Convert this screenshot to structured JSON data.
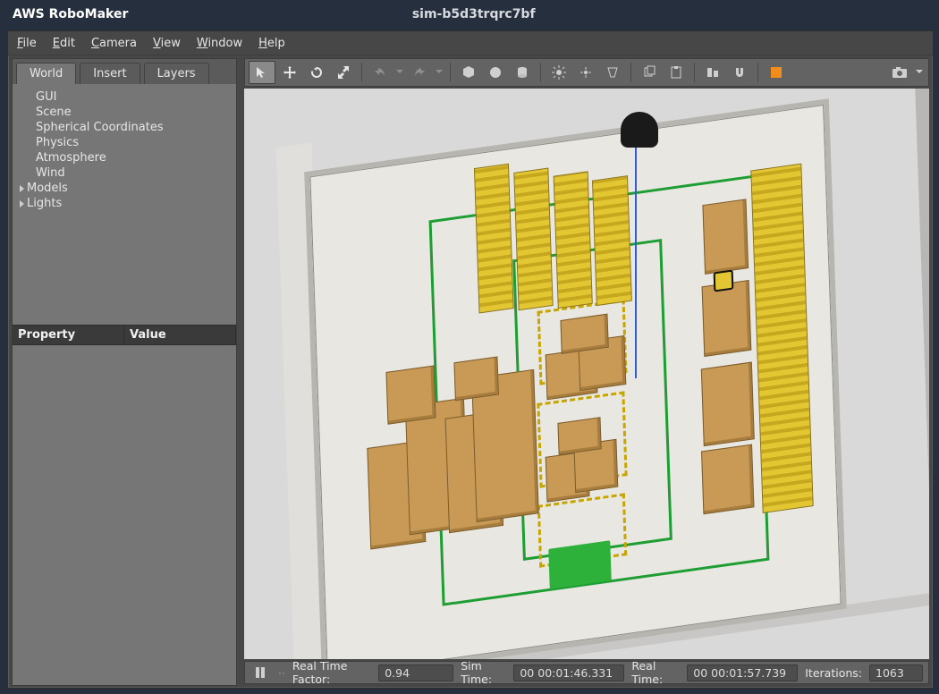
{
  "titlebar": {
    "app": "AWS RoboMaker",
    "document": "sim-b5d3trqrc7bf"
  },
  "menubar": [
    "File",
    "Edit",
    "Camera",
    "View",
    "Window",
    "Help"
  ],
  "left": {
    "tabs": [
      "World",
      "Insert",
      "Layers"
    ],
    "active_tab": "World",
    "tree": [
      "GUI",
      "Scene",
      "Spherical Coordinates",
      "Physics",
      "Atmosphere",
      "Wind"
    ],
    "tree_expandable": [
      "Models",
      "Lights"
    ],
    "prop_headers": [
      "Property",
      "Value"
    ]
  },
  "toolbar": {
    "items": [
      "select",
      "translate",
      "rotate",
      "scale",
      "|",
      "undo",
      "undo-dd",
      "redo",
      "redo-dd",
      "|",
      "box",
      "sphere",
      "cylinder",
      "|",
      "sun-light",
      "point-light",
      "spot-light",
      "|",
      "copy",
      "paste",
      "|",
      "align",
      "snap",
      "|",
      "record",
      "screenshot",
      "more"
    ]
  },
  "status": {
    "rtf_label": "Real Time Factor:",
    "rtf_value": "0.94",
    "sim_label": "Sim Time:",
    "sim_value": "00 00:01:46.331",
    "real_label": "Real Time:",
    "real_value": "00 00:01:57.739",
    "iter_label": "Iterations:",
    "iter_value": "1063"
  }
}
